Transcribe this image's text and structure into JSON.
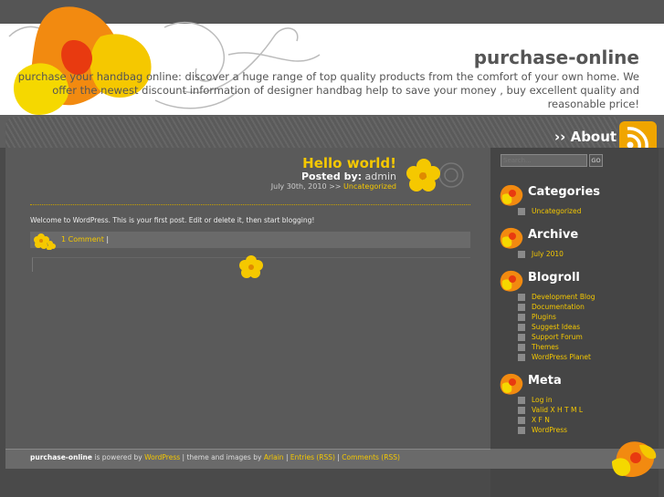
{
  "site": {
    "title": "purchase-online",
    "description": "purchase your handbag online: discover a huge range of top quality products from the comfort of your own home. We offer the newest discount information of designer handbag help to save your money , buy excellent quality and reasonable price!"
  },
  "nav": {
    "about": "›› About",
    "rss_icon": "rss-icon"
  },
  "post": {
    "title": "Hello world!",
    "posted_by_label": "Posted by:",
    "author": "admin",
    "date": "July 30th, 2010 >>",
    "category": "Uncategorized",
    "body": "Welcome to WordPress. This is your first post. Edit or delete it, then start blogging!",
    "comments": "1 Comment",
    "comment_sep": "|"
  },
  "footer": {
    "site": "purchase-online",
    "is_powered_by": "is powered by",
    "wordpress": "WordPress",
    "theme_text": "| theme and images by",
    "author": "Arlain",
    "sep1": "|",
    "entries_rss": "Entries (RSS)",
    "sep2": "|",
    "comments_rss": "Comments (RSS)"
  },
  "sidebar": {
    "search_placeholder": "Search...",
    "search_button": "GO",
    "categories": {
      "title": "Categories",
      "items": [
        "Uncategorized"
      ]
    },
    "archive": {
      "title": "Archive",
      "items": [
        "July 2010"
      ]
    },
    "blogroll": {
      "title": "Blogroll",
      "items": [
        "Development Blog",
        "Documentation",
        "Plugins",
        "Suggest Ideas",
        "Support Forum",
        "Themes",
        "WordPress Planet"
      ]
    },
    "meta": {
      "title": "Meta",
      "items": [
        "Log in",
        "Valid X H T M L",
        "X F N",
        "WordPress"
      ]
    }
  },
  "colors": {
    "accent": "#f5c800",
    "background": "#4a4a4a",
    "header": "#ffffff"
  }
}
